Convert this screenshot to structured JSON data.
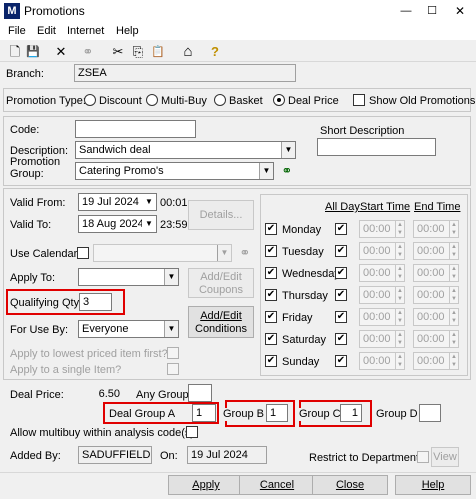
{
  "window": {
    "title": "Promotions",
    "logo_text": "M",
    "minimize": "—",
    "maximize": "☐",
    "close": "✕"
  },
  "menu": [
    "File",
    "Edit",
    "Internet",
    "Help"
  ],
  "toolbar": {
    "icons": [
      "new-icon",
      "save-icon",
      "delete-icon",
      "binoculars-icon",
      "cut-icon",
      "copy-icon",
      "paste-icon",
      "home-icon",
      "help-icon"
    ],
    "glyphs": [
      "🗋",
      "💾",
      "✕",
      "⚭",
      "✂",
      "⎘",
      "📋",
      "⌂",
      "?"
    ]
  },
  "branch": {
    "label": "Branch:",
    "value": "ZSEA"
  },
  "promotion_type": {
    "label": "Promotion Type:",
    "options": [
      "Discount",
      "Multi-Buy",
      "Basket",
      "Deal Price"
    ],
    "selected": "Deal Price",
    "show_old_label": "Show Old Promotions"
  },
  "code": {
    "label": "Code:",
    "value": ""
  },
  "short_description": {
    "label": "Short Description",
    "value": ""
  },
  "description": {
    "label": "Description:",
    "value": "Sandwich deal"
  },
  "promotion_group": {
    "label_line1": "Promotion",
    "label_line2": "Group:",
    "value": "Catering Promo's"
  },
  "valid_from": {
    "label": "Valid From:",
    "date": "19  Jul  2024",
    "time": "00:01"
  },
  "valid_to": {
    "label": "Valid To:",
    "date": "18 Aug 2024",
    "time": "23:59"
  },
  "details_button": "Details...",
  "use_calendar": {
    "label": "Use Calendar:"
  },
  "apply_to": {
    "label": "Apply To:",
    "value": ""
  },
  "add_edit_coupons": {
    "line1": "Add/Edit",
    "line2": "Coupons"
  },
  "add_edit_conditions": {
    "line1": "Add/Edit",
    "line2": "Conditions"
  },
  "qualifying_qty": {
    "label": "Qualifying Qty:",
    "value": "3"
  },
  "for_use_by": {
    "label": "For Use By:",
    "value": "Everyone"
  },
  "apply_lowest": "Apply to lowest priced item first?",
  "apply_single": "Apply to a single Item?",
  "schedule": {
    "headers": {
      "all_day": "All Day",
      "start": "Start Time",
      "end": "End Time"
    },
    "days": [
      {
        "name": "Monday",
        "start": "00:00",
        "end": "00:00"
      },
      {
        "name": "Tuesday",
        "start": "00:00",
        "end": "00:00"
      },
      {
        "name": "Wednesday",
        "start": "00:00",
        "end": "00:00"
      },
      {
        "name": "Thursday",
        "start": "00:00",
        "end": "00:00"
      },
      {
        "name": "Friday",
        "start": "00:00",
        "end": "00:00"
      },
      {
        "name": "Saturday",
        "start": "00:00",
        "end": "00:00"
      },
      {
        "name": "Sunday",
        "start": "00:00",
        "end": "00:00"
      }
    ]
  },
  "deal_price": {
    "label": "Deal Price:",
    "value": "6.50"
  },
  "any_group": {
    "label": "Any Group",
    "value": ""
  },
  "deal_group_a": {
    "label": "Deal Group A",
    "value": "1"
  },
  "group_b": {
    "label": "Group B",
    "value": "1"
  },
  "group_c": {
    "label": "Group C",
    "value": "1"
  },
  "group_d": {
    "label": "Group D",
    "value": ""
  },
  "multibuy_label": "Allow multibuy within analysis code(s)",
  "added_by": {
    "label": "Added By:",
    "value": "SADUFFIELD",
    "on_label": "On:",
    "on_value": "19 Jul 2024"
  },
  "restrict_label": "Restrict to Departments",
  "view_button": "View",
  "footer": {
    "apply": "Apply",
    "cancel": "Cancel",
    "close": "Close",
    "help": "Help"
  },
  "colors": {
    "accent": "#0a246a",
    "highlight": "#e00000"
  }
}
